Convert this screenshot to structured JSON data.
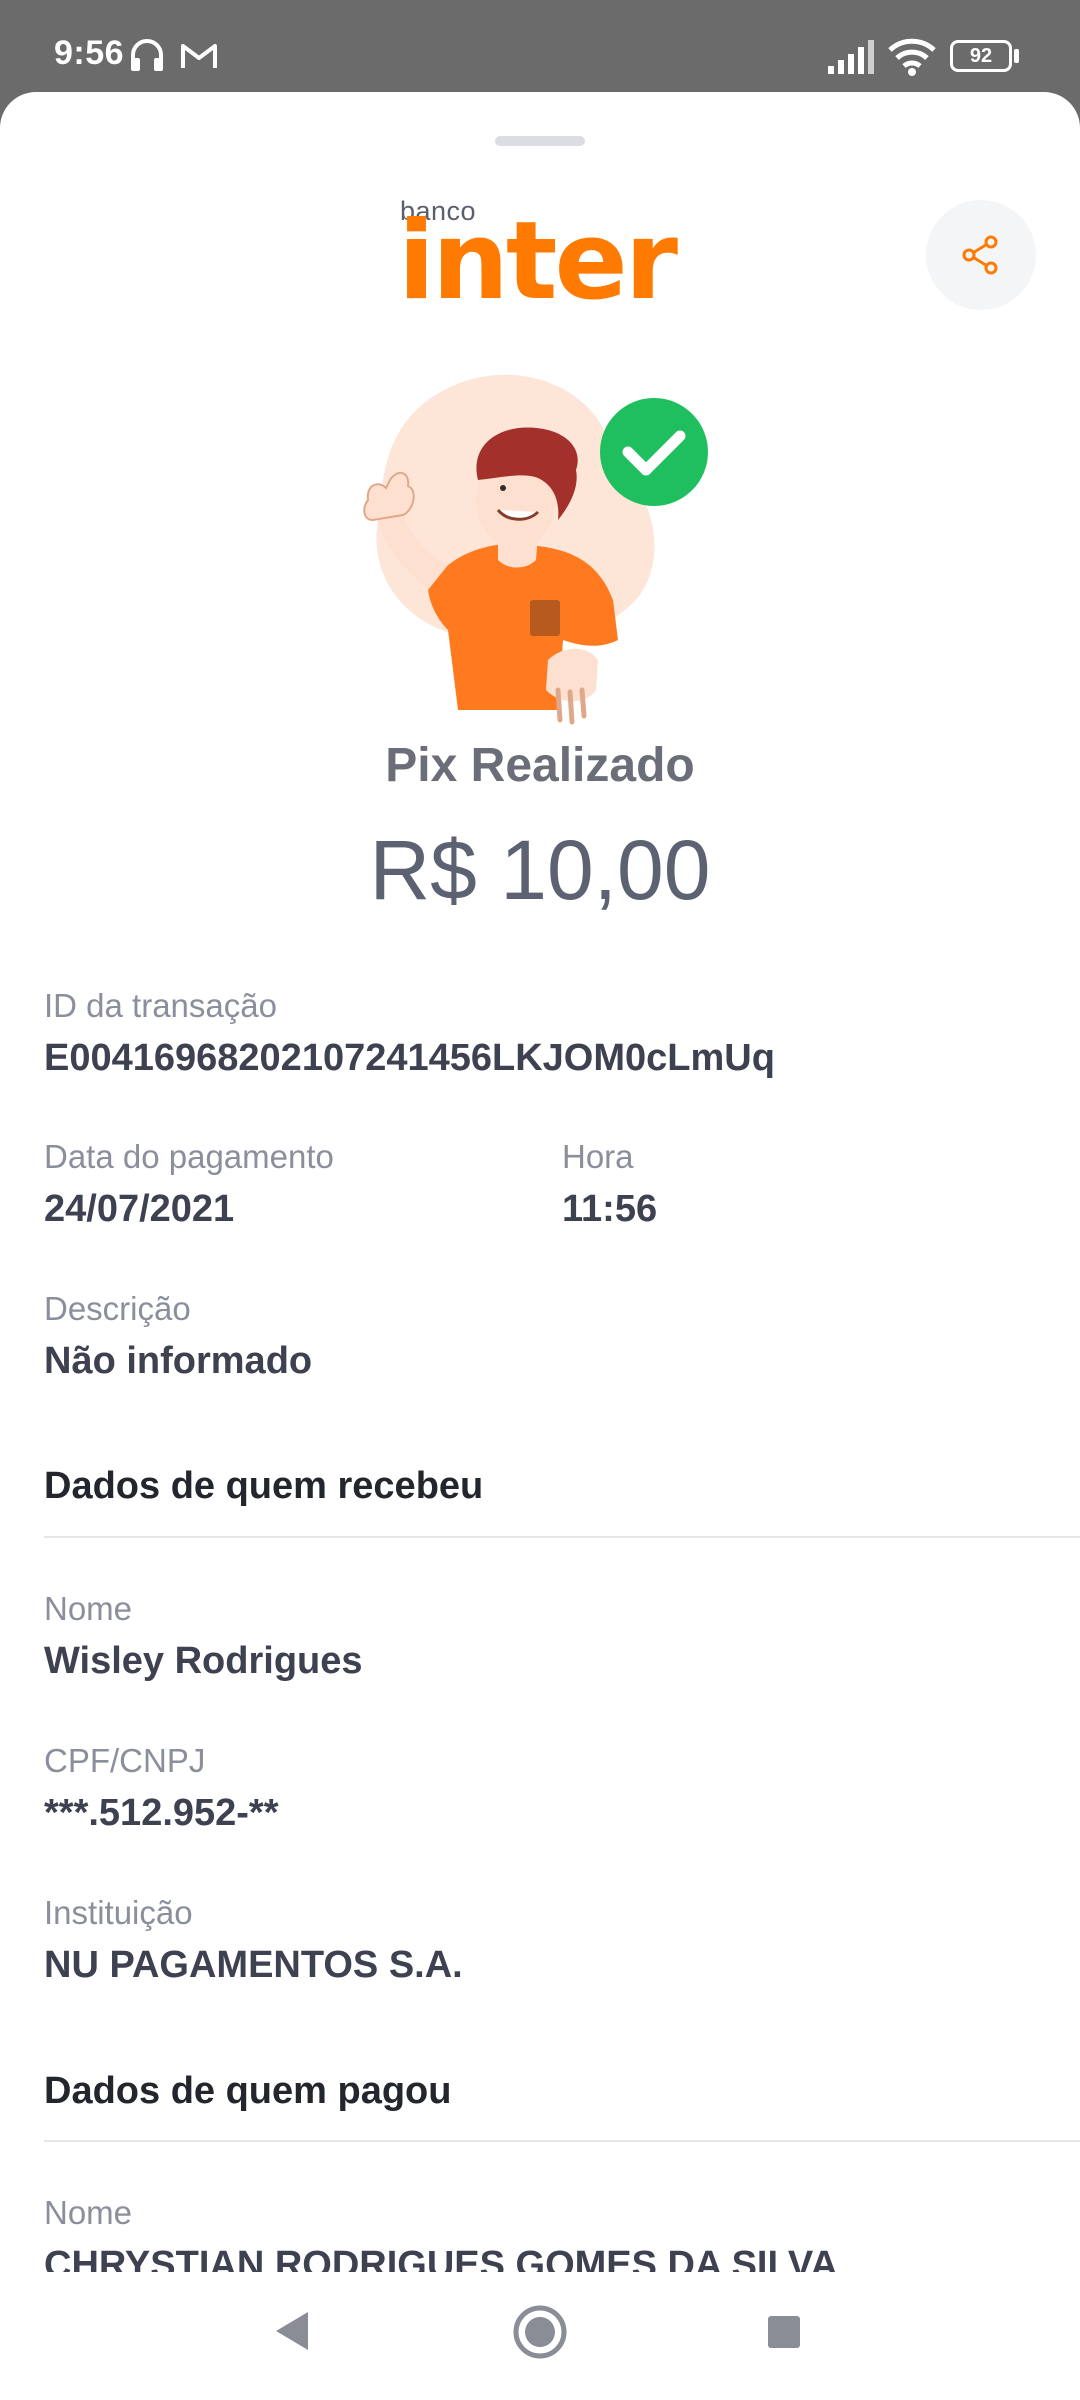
{
  "status_bar": {
    "time": "9:56",
    "battery": "92",
    "icons": [
      "headset-icon",
      "gmail-icon",
      "signal-icon",
      "wifi-icon",
      "battery-icon"
    ]
  },
  "brand": {
    "small": "banco",
    "name": "inter",
    "color": "#ff7a00"
  },
  "header": {
    "share_icon": "share-icon"
  },
  "receipt": {
    "title": "Pix Realizado",
    "currency": "R$",
    "amount": "10,00",
    "transaction_id_label": "ID da transação",
    "transaction_id": "E00416968202107241456LKJOM0cLmUq",
    "date_label": "Data do pagamento",
    "date": "24/07/2021",
    "time_label": "Hora",
    "time": "11:56",
    "description_label": "Descrição",
    "description": "Não informado"
  },
  "receiver": {
    "section_title": "Dados de quem recebeu",
    "name_label": "Nome",
    "name": "Wisley Rodrigues",
    "doc_label": "CPF/CNPJ",
    "doc": "***.512.952-**",
    "institution_label": "Instituição",
    "institution": "NU PAGAMENTOS S.A."
  },
  "payer": {
    "section_title": "Dados de quem pagou",
    "name_label": "Nome",
    "name": "CHRYSTIAN RODRIGUES GOMES DA SILVA"
  },
  "nav": {
    "icons": [
      "back-icon",
      "home-icon",
      "recents-icon"
    ]
  }
}
